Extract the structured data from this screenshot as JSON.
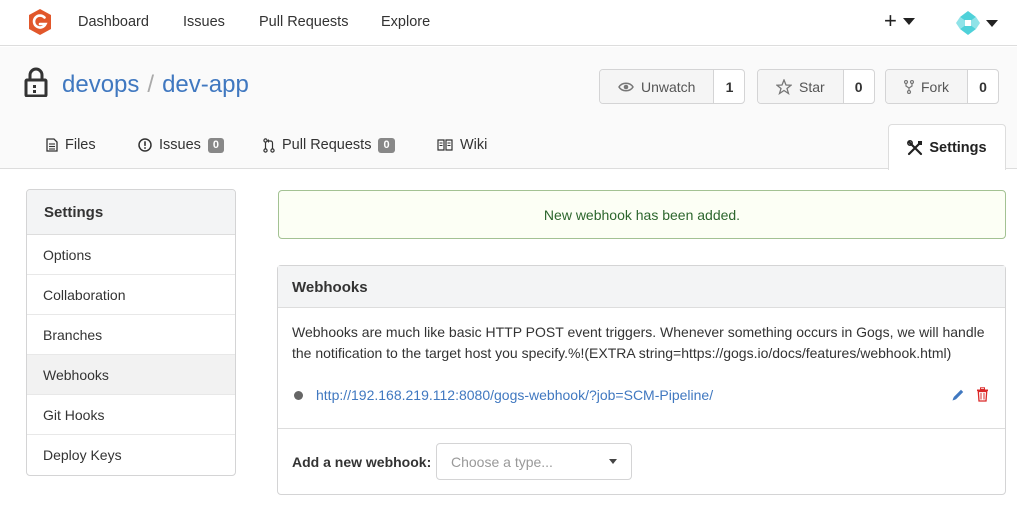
{
  "nav": {
    "items": [
      "Dashboard",
      "Issues",
      "Pull Requests",
      "Explore"
    ],
    "plus": "+"
  },
  "repo": {
    "owner": "devops",
    "separator": "/",
    "name": "dev-app",
    "watch": {
      "label": "Unwatch",
      "count": "1"
    },
    "star": {
      "label": "Star",
      "count": "0"
    },
    "fork": {
      "label": "Fork",
      "count": "0"
    }
  },
  "tabs": {
    "files": "Files",
    "issues": {
      "label": "Issues",
      "count": "0"
    },
    "pulls": {
      "label": "Pull Requests",
      "count": "0"
    },
    "wiki": "Wiki",
    "settings": "Settings"
  },
  "sidebar": {
    "title": "Settings",
    "items": [
      {
        "label": "Options"
      },
      {
        "label": "Collaboration"
      },
      {
        "label": "Branches"
      },
      {
        "label": "Webhooks"
      },
      {
        "label": "Git Hooks"
      },
      {
        "label": "Deploy Keys"
      }
    ],
    "active_index": 3
  },
  "flash": {
    "message": "New webhook has been added."
  },
  "webhooks": {
    "title": "Webhooks",
    "description": "Webhooks are much like basic HTTP POST event triggers. Whenever something occurs in Gogs, we will handle the notification to the target host you specify.%!(EXTRA string=https://gogs.io/docs/features/webhook.html)",
    "hooks": [
      {
        "url": "http://192.168.219.112:8080/gogs-webhook/?job=SCM-Pipeline/"
      }
    ],
    "add_label": "Add a new webhook:",
    "select_placeholder": "Choose a type..."
  },
  "colors": {
    "link": "#4078c0",
    "success_bg": "#fcfff5",
    "success_border": "#a3c293",
    "success_text": "#2c662d",
    "delete": "#db2828",
    "logo": "#e1572b",
    "avatar": "#4fd1d9"
  },
  "icons": {
    "logo": "gogs-logo-icon",
    "lock": "lock-icon",
    "watch": "eye-icon",
    "star": "star-icon",
    "fork": "fork-icon",
    "files": "file-icon",
    "issues": "issue-opened-icon",
    "pulls": "git-pull-request-icon",
    "wiki": "book-icon",
    "settings": "tools-icon",
    "edit": "pencil-icon",
    "delete": "trash-icon"
  }
}
